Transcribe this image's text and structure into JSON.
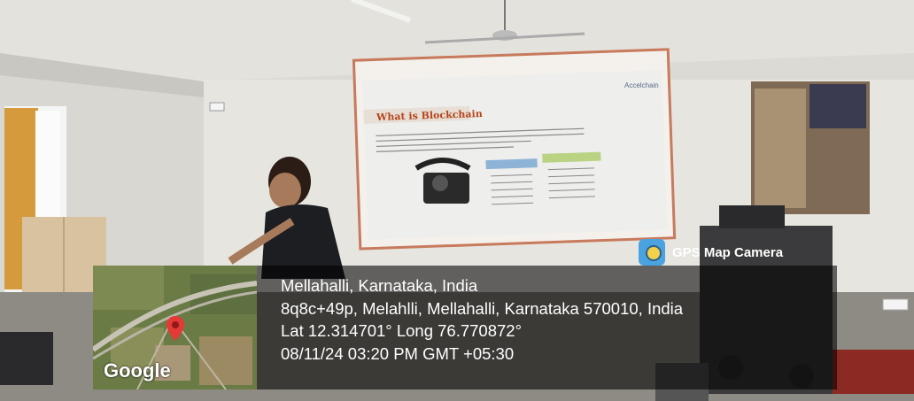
{
  "slide": {
    "title": "What is Blockchain",
    "brand": "Accelchain"
  },
  "overlay": {
    "app_name": "GPS Map Camera",
    "icon": "gps-map-camera-icon",
    "map_logo": "Google",
    "location": "Mellahalli, Karnataka, India",
    "address": "8q8c+49p, Melahlli, Mellahalli, Karnataka 570010, India",
    "coordinates": "Lat 12.314701° Long 76.770872°",
    "datetime": "08/11/24 03:20 PM GMT +05:30"
  }
}
